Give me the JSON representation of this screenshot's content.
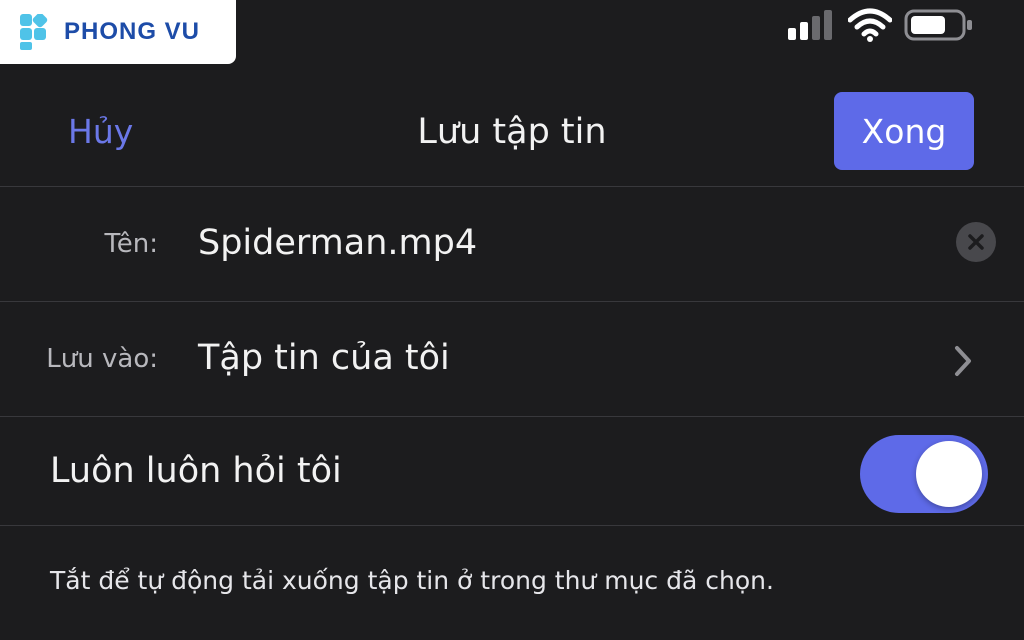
{
  "status_bar": {
    "logo_text": "PHONG VU",
    "icons": [
      "signal-icon",
      "wifi-icon",
      "battery-icon"
    ]
  },
  "nav": {
    "cancel_label": "Hủy",
    "title": "Lưu tập tin",
    "done_label": "Xong"
  },
  "form": {
    "name_label": "Tên:",
    "name_value": "Spiderman.mp4",
    "location_label": "Lưu vào:",
    "location_value": "Tập tin của tôi",
    "always_ask_label": "Luôn luôn hỏi tôi",
    "always_ask_on": true
  },
  "footer_note": "Tắt để tự động tải xuống tập tin ở trong thư mục đã chọn.",
  "colors": {
    "accent": "#5e6ae8",
    "cancel_text": "#6b78e8",
    "background": "#1c1c1e",
    "divider": "#38383c",
    "logo_blue": "#1d4ca8",
    "logo_cyan": "#4fc3e8"
  }
}
